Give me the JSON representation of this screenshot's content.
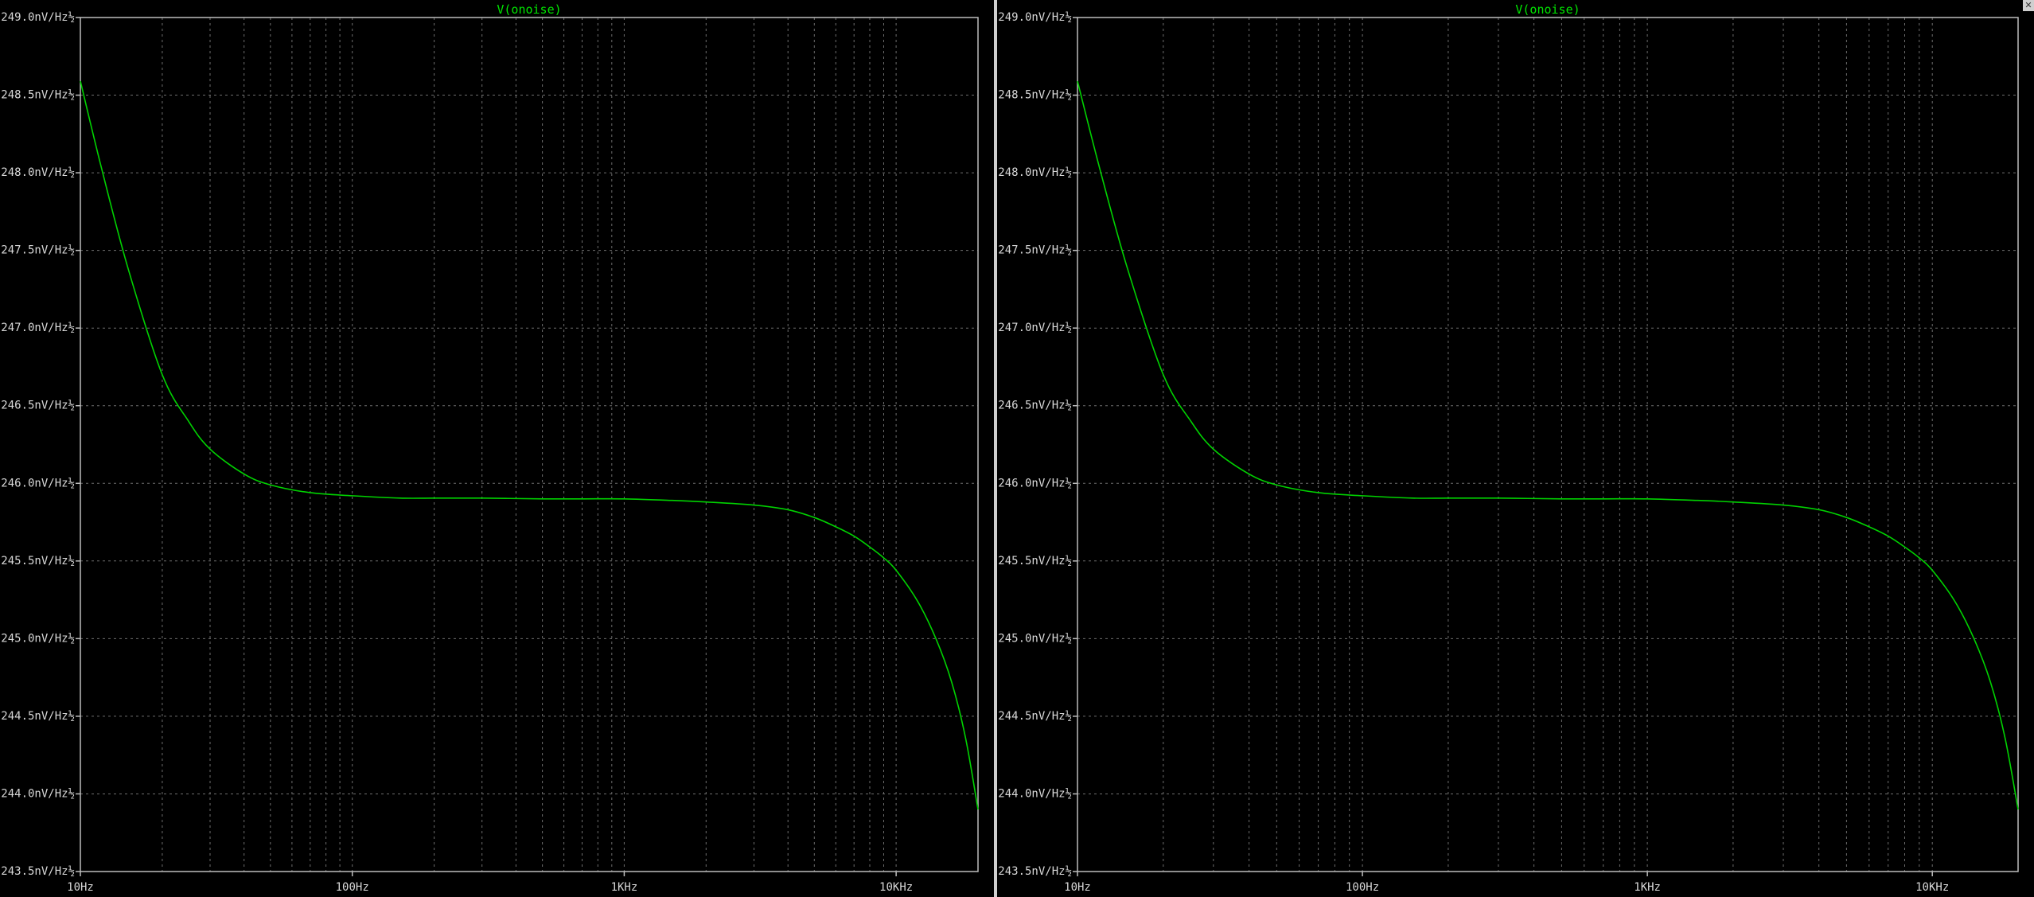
{
  "window": {
    "close_label": "✕"
  },
  "colors": {
    "background": "#000000",
    "frame": "#bdbdbd",
    "grid": "#6e6e6e",
    "trace": "#00d200",
    "title": "#00e600",
    "tick_text": "#d8d8d8"
  },
  "chart_data": [
    {
      "type": "line",
      "title": "V(onoise)",
      "x_scale": "log",
      "xlim": [
        10,
        20000
      ],
      "ylim": [
        243.5,
        249.0
      ],
      "x_tick_labels": [
        {
          "value": 10,
          "label": "10Hz"
        },
        {
          "value": 100,
          "label": "100Hz"
        },
        {
          "value": 1000,
          "label": "1KHz"
        },
        {
          "value": 10000,
          "label": "10KHz"
        }
      ],
      "y_tick_labels": [
        {
          "value": 249.0,
          "label": "249.0nV/Hz½"
        },
        {
          "value": 248.5,
          "label": "248.5nV/Hz½"
        },
        {
          "value": 248.0,
          "label": "248.0nV/Hz½"
        },
        {
          "value": 247.5,
          "label": "247.5nV/Hz½"
        },
        {
          "value": 247.0,
          "label": "247.0nV/Hz½"
        },
        {
          "value": 246.5,
          "label": "246.5nV/Hz½"
        },
        {
          "value": 246.0,
          "label": "246.0nV/Hz½"
        },
        {
          "value": 245.5,
          "label": "245.5nV/Hz½"
        },
        {
          "value": 245.0,
          "label": "245.0nV/Hz½"
        },
        {
          "value": 244.5,
          "label": "244.5nV/Hz½"
        },
        {
          "value": 244.0,
          "label": "244.0nV/Hz½"
        },
        {
          "value": 243.5,
          "label": "243.5nV/Hz½"
        }
      ],
      "grid": true,
      "series": [
        {
          "name": "V(onoise)",
          "x": [
            10,
            12,
            15,
            20,
            25,
            30,
            40,
            50,
            70,
            100,
            150,
            200,
            300,
            500,
            700,
            1000,
            1500,
            2000,
            3000,
            4000,
            5000,
            6000,
            7000,
            8000,
            9000,
            10000,
            12000,
            14000,
            16000,
            18000,
            20000
          ],
          "y": [
            248.59,
            248.02,
            247.38,
            246.7,
            246.4,
            246.22,
            246.06,
            245.99,
            245.94,
            245.92,
            245.905,
            245.905,
            245.905,
            245.9,
            245.9,
            245.9,
            245.89,
            245.88,
            245.86,
            245.83,
            245.78,
            245.72,
            245.66,
            245.59,
            245.52,
            245.44,
            245.24,
            245.0,
            244.72,
            244.36,
            243.9
          ]
        }
      ]
    },
    {
      "type": "line",
      "title": "V(onoise)",
      "x_scale": "log",
      "xlim": [
        10,
        20000
      ],
      "ylim": [
        243.5,
        249.0
      ],
      "x_tick_labels": [
        {
          "value": 10,
          "label": "10Hz"
        },
        {
          "value": 100,
          "label": "100Hz"
        },
        {
          "value": 1000,
          "label": "1KHz"
        },
        {
          "value": 10000,
          "label": "10KHz"
        }
      ],
      "y_tick_labels": [
        {
          "value": 249.0,
          "label": "249.0nV/Hz½"
        },
        {
          "value": 248.5,
          "label": "248.5nV/Hz½"
        },
        {
          "value": 248.0,
          "label": "248.0nV/Hz½"
        },
        {
          "value": 247.5,
          "label": "247.5nV/Hz½"
        },
        {
          "value": 247.0,
          "label": "247.0nV/Hz½"
        },
        {
          "value": 246.5,
          "label": "246.5nV/Hz½"
        },
        {
          "value": 246.0,
          "label": "246.0nV/Hz½"
        },
        {
          "value": 245.5,
          "label": "245.5nV/Hz½"
        },
        {
          "value": 245.0,
          "label": "245.0nV/Hz½"
        },
        {
          "value": 244.5,
          "label": "244.5nV/Hz½"
        },
        {
          "value": 244.0,
          "label": "244.0nV/Hz½"
        },
        {
          "value": 243.5,
          "label": "243.5nV/Hz½"
        }
      ],
      "grid": true,
      "series": [
        {
          "name": "V(onoise)",
          "x": [
            10,
            12,
            15,
            20,
            25,
            30,
            40,
            50,
            70,
            100,
            150,
            200,
            300,
            500,
            700,
            1000,
            1500,
            2000,
            3000,
            4000,
            5000,
            6000,
            7000,
            8000,
            9000,
            10000,
            12000,
            14000,
            16000,
            18000,
            20000
          ],
          "y": [
            248.59,
            248.02,
            247.38,
            246.7,
            246.4,
            246.22,
            246.06,
            245.99,
            245.94,
            245.92,
            245.905,
            245.905,
            245.905,
            245.9,
            245.9,
            245.9,
            245.89,
            245.88,
            245.86,
            245.83,
            245.78,
            245.72,
            245.66,
            245.59,
            245.52,
            245.44,
            245.24,
            245.0,
            244.72,
            244.36,
            243.9
          ]
        }
      ]
    }
  ]
}
